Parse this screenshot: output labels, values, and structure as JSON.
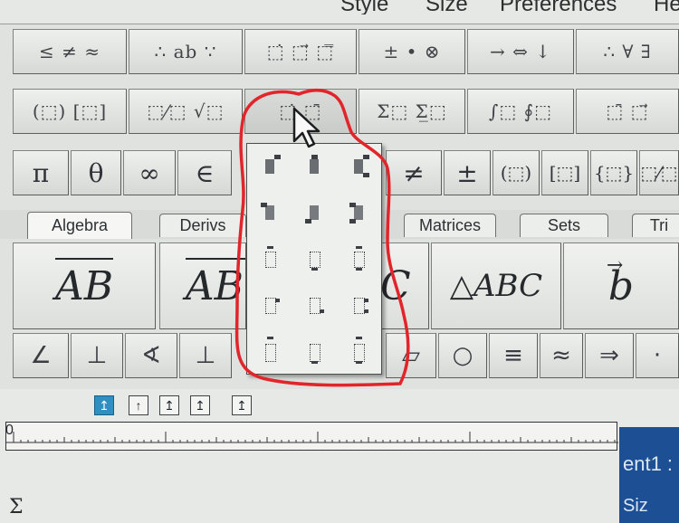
{
  "menubar": {
    "items": [
      "Style",
      "Size",
      "Preferences",
      "He"
    ]
  },
  "palette_row1": [
    "≤ ≠ ≈",
    "∴ ab ∵",
    "⬚̇ ⬚⃗ ⬚̿",
    "± • ⊗",
    "→ ⇔ ↓",
    "∴ ∀ ∃"
  ],
  "palette_row2": [
    "(⬚) [⬚]",
    "⬚⁄⬚ √⬚",
    "⬚̇ ⬚̄",
    "Σ⬚ Σ̲⬚",
    "∫⬚ ∮⬚",
    "⬚̄ ⬚⃗"
  ],
  "symbols_left": [
    "π",
    "θ",
    "∞",
    "∈"
  ],
  "symbols_right": [
    "≠",
    "±",
    "(⬚)",
    "[⬚]",
    "{⬚}",
    "⬚⁄⬚"
  ],
  "tabs": [
    "Algebra",
    "Derivs",
    "Matrices",
    "Sets",
    "Tri"
  ],
  "templates": {
    "vector_ab": "AB",
    "vector_ab_partial": "AB",
    "arc_c": "C",
    "triangle_abc": "△ABC",
    "vector_b": "b"
  },
  "bottom_symbols": [
    "∠",
    "⊥",
    "∢",
    "⊥",
    "▱",
    "○",
    "≡",
    "≈",
    "⇒",
    "·"
  ],
  "dropdown": {
    "items": [
      "dot-upper-right",
      "dot-upper-center",
      "dot-upper-double",
      "dot-mid-left",
      "dot-mid-center",
      "dot-mid-double",
      "box-outline-1",
      "box-outline-2",
      "box-outline-3",
      "box-lower-right",
      "box-lower-center",
      "box-lower-double",
      "box-under-1",
      "box-under-2",
      "box-under-3"
    ]
  },
  "align_buttons": [
    "↥",
    "↑",
    "↥",
    "↥",
    "↥"
  ],
  "ruler": {
    "zero_label": "0"
  },
  "document": {
    "title_fragment": "ent1 :",
    "size_label": "Siz",
    "separator": ":"
  },
  "cursor_char": "Σ",
  "colors": {
    "annotation": "#e1252b",
    "active_button": "#2f8fc0",
    "document_panel": "#1d4f95"
  }
}
